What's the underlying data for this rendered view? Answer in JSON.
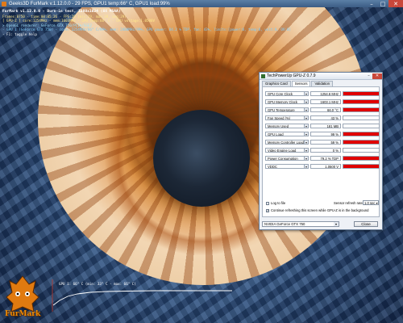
{
  "furmark_window": {
    "title": "Geeks3D FurMark v.1.12.0.0 - 29 FPS, GPU1 temp:66° C, GPU1 load:99%",
    "controls": {
      "minimize": "–",
      "maximize": "□",
      "close": "✕"
    }
  },
  "osd": {
    "line1": "FurMark v1.12.0.0 - Burn-in test, 1280x1024 (8X MSAA)",
    "line2": "Frames:8750 - time:00:05:26 - FPS:29 (min:29, max:38, avg:29)",
    "line3": "[ GPU-Z ] core:1254MHz - mem:1603MHz - GPU temp:66° C - GPU voltage:1.0500V",
    "line4": "> OpenGL renderer: GeForce GTX 750/PCIe/SSE2",
    "line5": "- GPU 1 (GeForce GTX 750) - core: 1254MHz/66° C/99%, mem: 2400MHz/99%, GPU power: 84.2 % TDP, fan: 43%, limits:[power:0, temp:0, volt:0, OV:0]",
    "line6": "- F1: toggle help"
  },
  "graph": {
    "label": "GPU 1: 66° C (min: 33° C - max: 66° C)",
    "line_color": "#ffffff"
  },
  "logo": {
    "text": "FurMark",
    "color": "#f08a00"
  },
  "gpuz": {
    "title": "TechPowerUp GPU-Z 0.7.9",
    "controls": {
      "minimize": "–",
      "close": "✕"
    },
    "tabs": [
      {
        "label": "Graphics Card",
        "active": false
      },
      {
        "label": "Sensors",
        "active": true
      },
      {
        "label": "Validation",
        "active": false
      }
    ],
    "sensors": [
      {
        "name": "GPU Core Clock",
        "value": "1254.6 MHz",
        "fill": 1.0
      },
      {
        "name": "GPU Memory Clock",
        "value": "1603.1 MHz",
        "fill": 1.0
      },
      {
        "name": "GPU Temperature",
        "value": "66.0 °C",
        "fill": 1.0
      },
      {
        "name": "Fan Speed (%)",
        "value": "43 %",
        "fill": 0.0
      },
      {
        "name": "Memory Used",
        "value": "181 MB",
        "fill": 0.0
      },
      {
        "name": "GPU Load",
        "value": "99 %",
        "fill": 1.0
      },
      {
        "name": "Memory Controller Load",
        "value": "59 %",
        "fill": 1.0
      },
      {
        "name": "Video Engine Load",
        "value": "0 %",
        "fill": 0.0
      },
      {
        "name": "Power Consumption",
        "value": "79.2 % TDP",
        "fill": 1.0
      },
      {
        "name": "VDDC",
        "value": "1.0500 V",
        "fill": 1.0
      }
    ],
    "log_to_file": "Log to file",
    "refresh_rate_label": "Sensor refresh rate:",
    "refresh_rate_value": "1.0 sec",
    "continue_refresh": "Continue refreshing this screen while GPU-Z is in the background",
    "gpu_name": "NVIDIA GeForce GTX 750",
    "close_label": "Close",
    "bar_color": "#e00000"
  }
}
